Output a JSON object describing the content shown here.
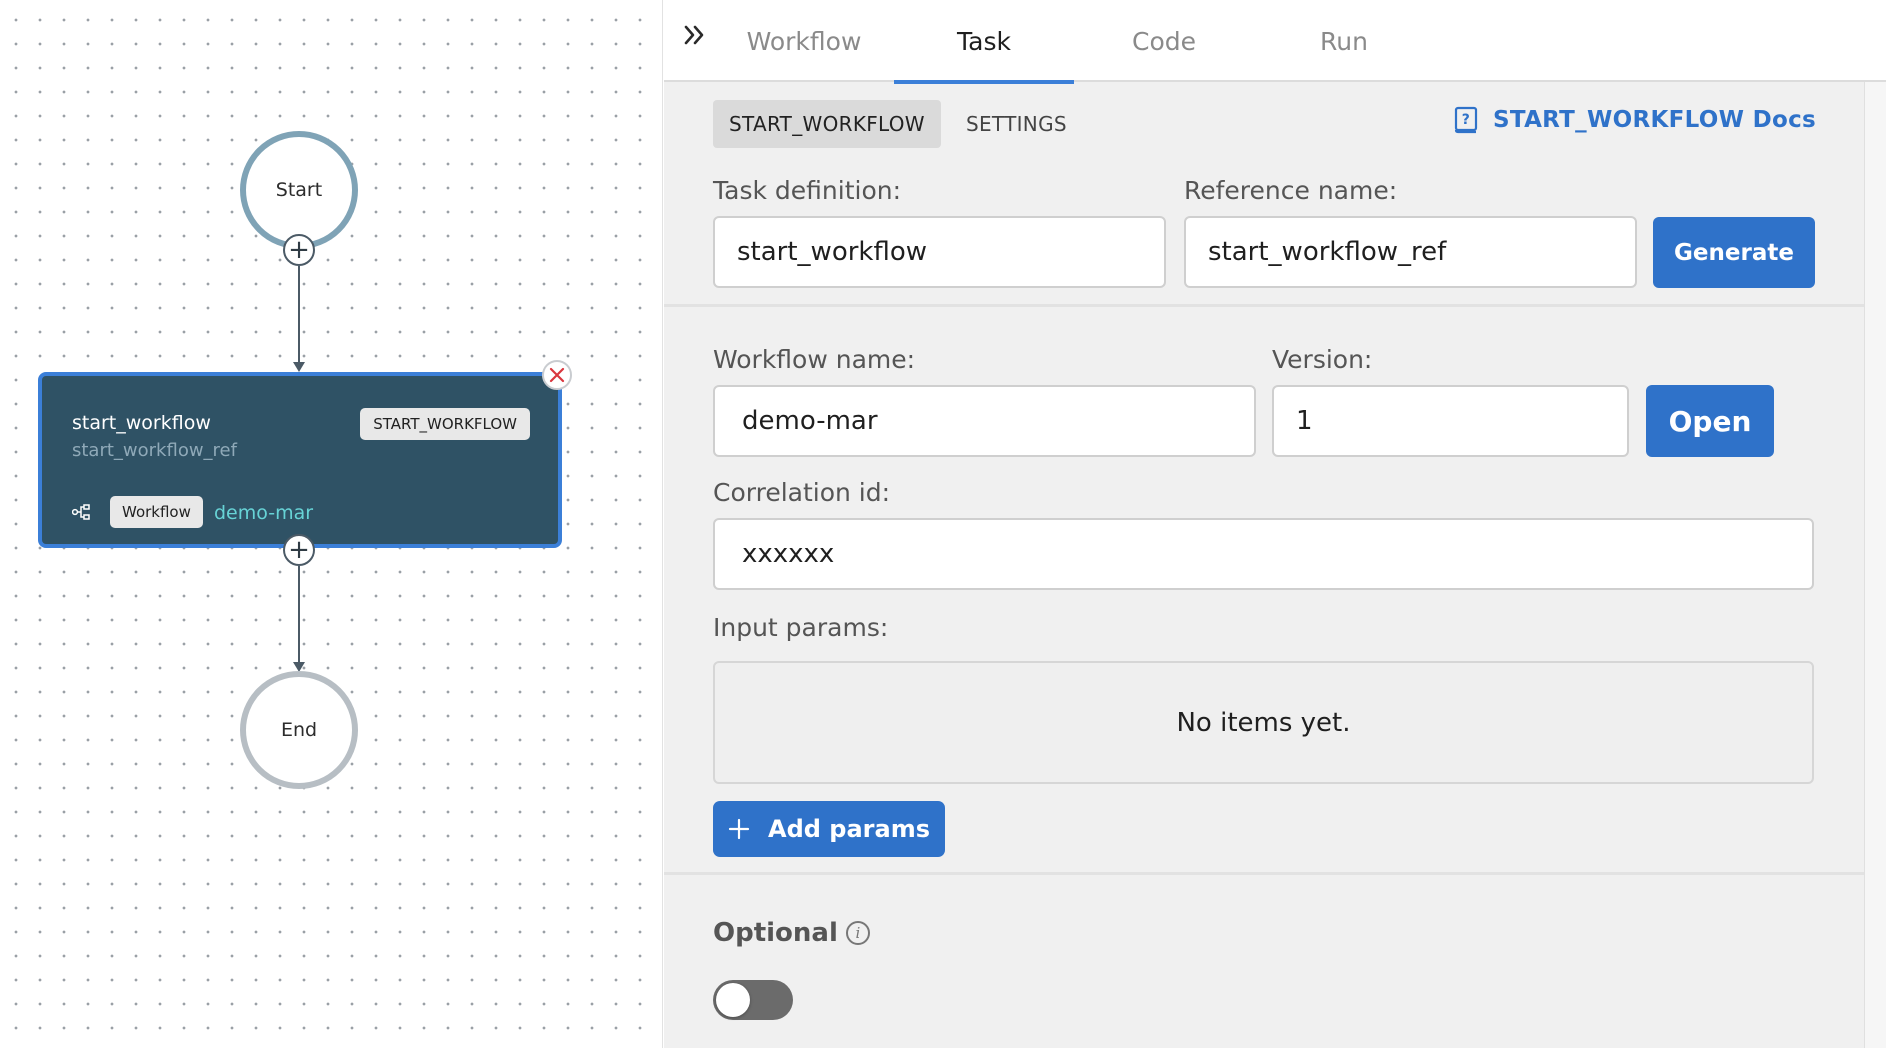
{
  "canvas": {
    "start_label": "Start",
    "end_label": "End",
    "task_node": {
      "name": "start_workflow",
      "reference": "start_workflow_ref",
      "type_chip": "START_WORKFLOW",
      "workflow_chip": "Workflow",
      "workflow_name": "demo-mar"
    }
  },
  "tabs": [
    {
      "label": "Workflow",
      "active": false
    },
    {
      "label": "Task",
      "active": true
    },
    {
      "label": "Code",
      "active": false
    },
    {
      "label": "Run",
      "active": false
    }
  ],
  "subtabs": {
    "active": "START_WORKFLOW",
    "inactive": "SETTINGS"
  },
  "docs_link": "START_WORKFLOW Docs",
  "task_definition": {
    "label": "Task definition:",
    "value": "start_workflow"
  },
  "reference_name": {
    "label": "Reference name:",
    "value": "start_workflow_ref"
  },
  "generate_button": "Generate",
  "workflow_name": {
    "label": "Workflow name:",
    "value": "demo-mar"
  },
  "version": {
    "label": "Version:",
    "value": "1"
  },
  "open_button": "Open",
  "correlation_id": {
    "label": "Correlation id:",
    "value": "xxxxxx"
  },
  "input_params": {
    "label": "Input params:",
    "empty_text": "No items yet."
  },
  "add_params_button": "Add params",
  "optional": {
    "label": "Optional",
    "enabled": false
  },
  "colors": {
    "accent": "#2f72c9",
    "task_card_bg": "#2f5265",
    "task_card_border": "#3b7fd8",
    "workflow_name_text": "#67d3d6",
    "close_icon": "#d9363e"
  }
}
